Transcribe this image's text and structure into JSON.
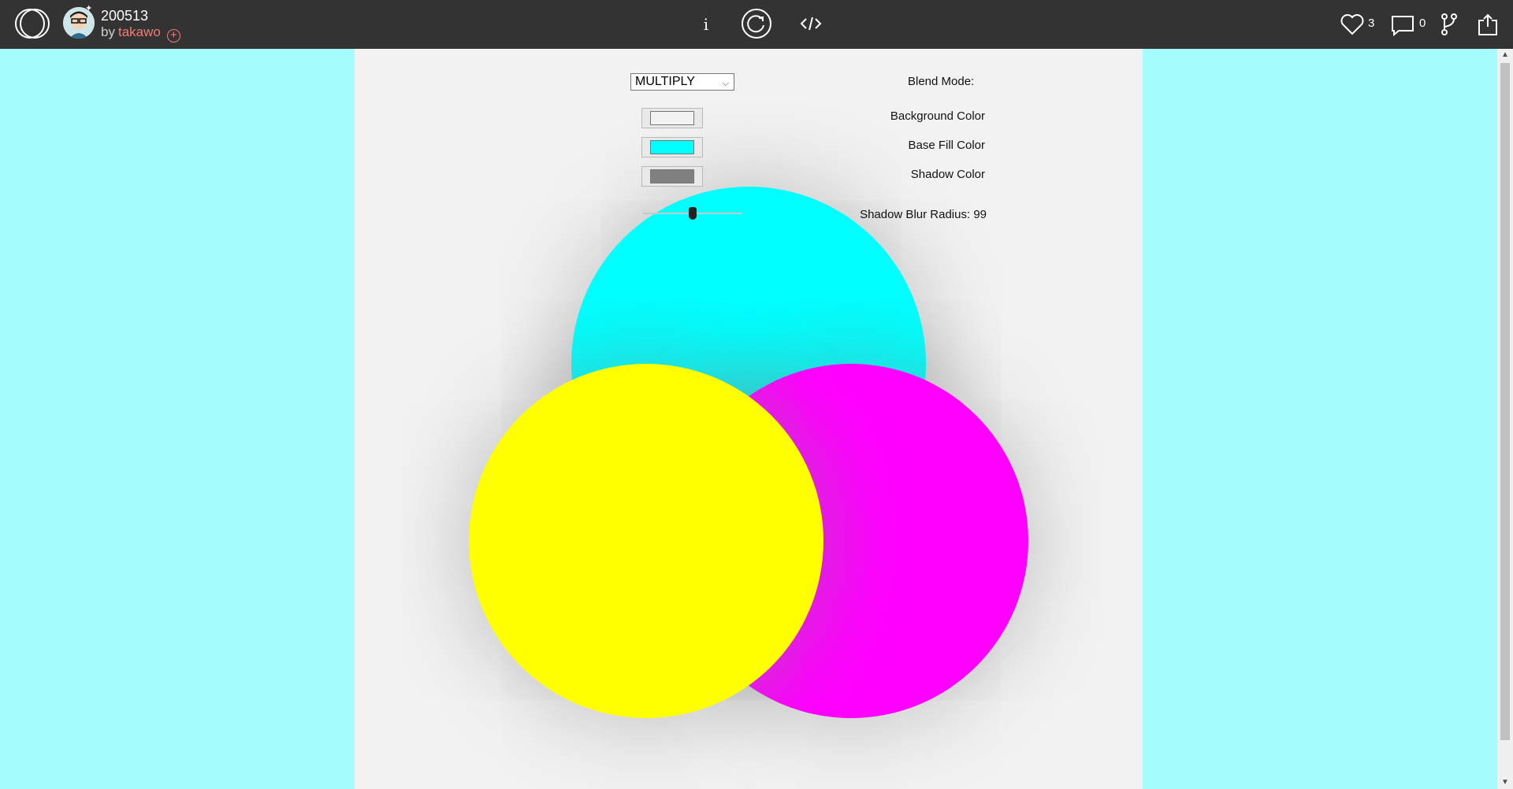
{
  "header": {
    "sketch_title": "200513",
    "by_prefix": "by",
    "author": "takawo",
    "follow_symbol": "+",
    "info_label": "i",
    "like_count": "3",
    "comment_count": "0"
  },
  "controls": {
    "blend_mode": {
      "label": "Blend Mode:",
      "selected": "MULTIPLY"
    },
    "background_color": {
      "label": "Background Color",
      "value": "#f2f2f2"
    },
    "base_fill_color": {
      "label": "Base Fill Color",
      "value": "#00ffff"
    },
    "shadow_color": {
      "label": "Shadow Color",
      "value": "#808080"
    },
    "shadow_blur": {
      "label": "Shadow Blur Radius:",
      "value": "99"
    }
  },
  "circles": [
    {
      "name": "cyan",
      "color": "#00ffff"
    },
    {
      "name": "magenta",
      "color": "#ff00ff"
    },
    {
      "name": "yellow",
      "color": "#ffff00"
    }
  ],
  "colors": {
    "page_background": "#a5fcfc",
    "topbar": "#333333",
    "author_accent": "#f07b7b"
  }
}
